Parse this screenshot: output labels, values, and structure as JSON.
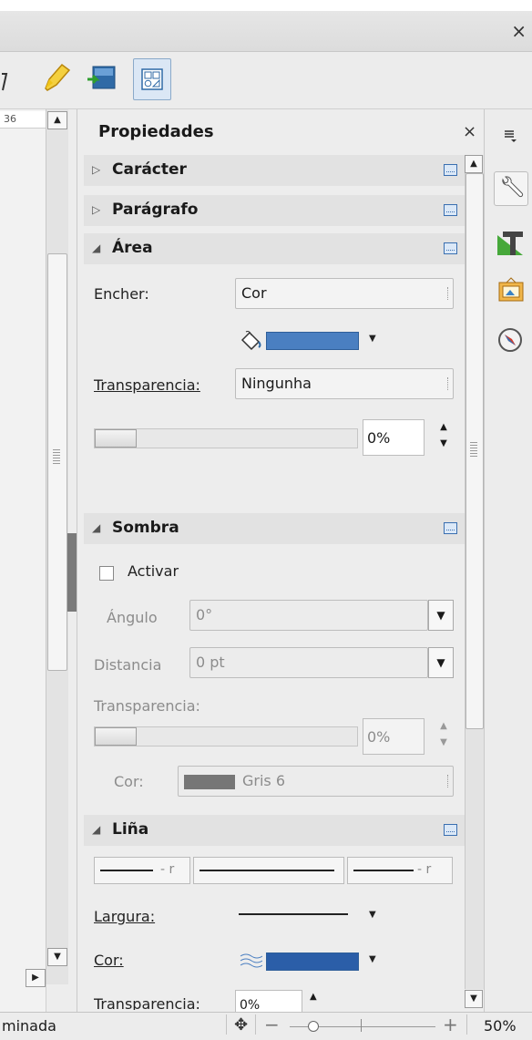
{
  "window": {
    "close_glyph": "×"
  },
  "toolbar": {
    "icons": [
      "highlighter-icon",
      "insert-frame-icon",
      "sidebar-toggle-icon"
    ]
  },
  "ruler": {
    "tick_label": "36"
  },
  "panel": {
    "title": "Propiedades",
    "close_glyph": "×",
    "sections": {
      "caracter": {
        "label": "Carácter",
        "collapsed": true
      },
      "paragrafo": {
        "label": "Parágrafo",
        "collapsed": true
      },
      "area": {
        "label": "Área",
        "fill_label": "Encher:",
        "fill_value": "Cor",
        "fill_color": "#4a7fc1",
        "transparency_label": "Transparencia:",
        "transparency_value": "Ningunha",
        "transparency_percent": "0%"
      },
      "sombra": {
        "label": "Sombra",
        "enable_label": "Activar",
        "enabled": false,
        "angle_label": "Ángulo",
        "angle_value": "0°",
        "distance_label": "Distancia",
        "distance_value": "0 pt",
        "transparency_label": "Transparencia:",
        "transparency_percent": "0%",
        "color_label": "Cor:",
        "color_value": "Gris 6",
        "color_swatch": "#767676"
      },
      "lina": {
        "label": "Liña",
        "start_arrow_text": "- r",
        "end_arrow_text": "- r",
        "width_label": "Largura:",
        "color_label": "Cor:",
        "color_swatch": "#2b5ea8",
        "transparency_label": "Transparencia:",
        "transparency_percent": "0%"
      }
    }
  },
  "deck": {
    "icons": [
      "menu-icon",
      "properties-wrench-icon",
      "styles-icon",
      "gallery-icon",
      "navigator-icon"
    ]
  },
  "status": {
    "text": "minada",
    "zoom_minus": "−",
    "zoom_plus": "+",
    "zoom_percent": "50%",
    "zoom_level": 0.5
  }
}
